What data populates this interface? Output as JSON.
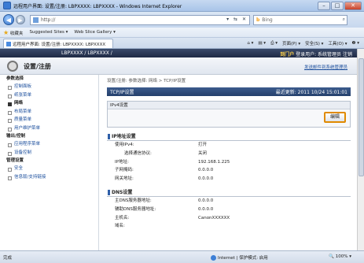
{
  "window": {
    "title": "远程用户界面: 设置/注册: LBPXXXX: LBPXXXX - Windows Internet Explorer"
  },
  "address": {
    "url": "http://",
    "search_placeholder": "Bing"
  },
  "favorites": {
    "label": "收藏夹",
    "items": [
      "Suggested Sites ▾",
      "Web Slice Gallery ▾"
    ]
  },
  "tab": {
    "label": "远程用户界面: 设置/注册: LBPXXXX: LBPXXXX"
  },
  "commandbar": {
    "page": "页面(P) ▾",
    "safety": "安全(S) ▾",
    "tools": "工具(O) ▾",
    "help": "❷ ▾"
  },
  "banner": {
    "model": "LBPXXXX / LBPXXXX /",
    "portal": "到门户",
    "login": "登录用户: 系统管理员",
    "logout": "注销"
  },
  "header": {
    "title": "设置/注册",
    "admin_link": "发送邮件到系统管理员"
  },
  "sidebar": {
    "sections": [
      {
        "label": "参数选择",
        "items": [
          {
            "label": "控制面板",
            "active": false
          },
          {
            "label": "纸张菜单",
            "active": false
          },
          {
            "label": "网络",
            "active": true
          },
          {
            "label": "布局菜单",
            "active": false
          },
          {
            "label": "质量菜单",
            "active": false
          },
          {
            "label": "用户维护菜单",
            "active": false
          }
        ]
      },
      {
        "label": "输出/控制",
        "items": [
          {
            "label": "应用程序菜单",
            "active": false
          },
          {
            "label": "设备控制",
            "active": false
          }
        ]
      },
      {
        "label": "管理设置",
        "items": [
          {
            "label": "安全",
            "active": false
          },
          {
            "label": "信息版/支持链接",
            "active": false
          }
        ]
      }
    ]
  },
  "main": {
    "breadcrumb": "设置/注册: 参数选择: 网络 > TCP/IP设置",
    "title": "TCP/IP设置",
    "last_updated": "最近更新: 2011 10/24 15:01:01",
    "ipv4_panel": "IPv4设置",
    "edit_label": "编辑",
    "ip_section": {
      "title": "IP地址设置",
      "rows": [
        {
          "key": "使用IPv4:",
          "value": "打开",
          "indent": false
        },
        {
          "key": "选择通信协议:",
          "value": "关闭",
          "indent": true
        },
        {
          "key": "IP地址:",
          "value": "192.168.1.225",
          "indent": false
        },
        {
          "key": "子网掩码:",
          "value": "0.0.0.0",
          "indent": false
        },
        {
          "key": "网关地址:",
          "value": "0.0.0.0",
          "indent": false
        }
      ]
    },
    "dns_section": {
      "title": "DNS设置",
      "rows": [
        {
          "key": "主DNS服务器地址:",
          "value": "0.0.0.0",
          "indent": false
        },
        {
          "key": "辅助DNS服务器地址:",
          "value": "0.0.0.0",
          "indent": false
        },
        {
          "key": "主机名:",
          "value": "CanonXXXXXX",
          "indent": false
        },
        {
          "key": "域名:",
          "value": "",
          "indent": false
        }
      ]
    }
  },
  "status": {
    "text": "完成",
    "zone": "Internet | 保护模式: 启用",
    "zoom": "100%"
  }
}
